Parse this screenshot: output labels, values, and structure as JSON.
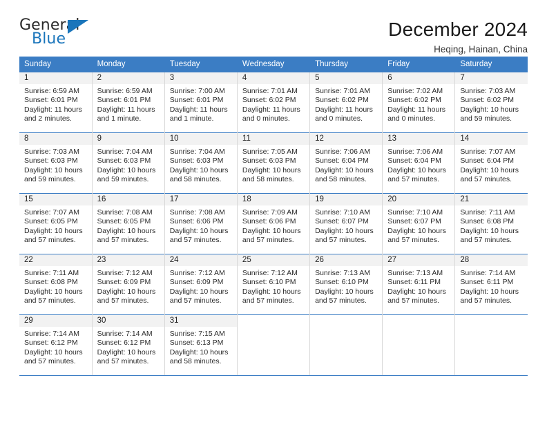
{
  "logo": {
    "word_one": "General",
    "word_two": "Blue",
    "flag_icon": "triangle-flag-icon"
  },
  "header": {
    "title": "December 2024",
    "location": "Heqing, Hainan, China"
  },
  "colors": {
    "header_blue": "#3b7dc4",
    "logo_blue": "#1a75bb",
    "daynum_band": "#f2f2f2",
    "cell_border": "#d8d8d8",
    "text": "#2b2b2b"
  },
  "weekday_headers": [
    "Sunday",
    "Monday",
    "Tuesday",
    "Wednesday",
    "Thursday",
    "Friday",
    "Saturday"
  ],
  "labels": {
    "sunrise_prefix": "Sunrise:",
    "sunset_prefix": "Sunset:",
    "daylight_prefix": "Daylight:"
  },
  "weeks": [
    [
      {
        "day": "1",
        "sunrise": "Sunrise: 6:59 AM",
        "sunset": "Sunset: 6:01 PM",
        "daylight_line1": "Daylight: 11 hours",
        "daylight_line2": "and 2 minutes."
      },
      {
        "day": "2",
        "sunrise": "Sunrise: 6:59 AM",
        "sunset": "Sunset: 6:01 PM",
        "daylight_line1": "Daylight: 11 hours",
        "daylight_line2": "and 1 minute."
      },
      {
        "day": "3",
        "sunrise": "Sunrise: 7:00 AM",
        "sunset": "Sunset: 6:01 PM",
        "daylight_line1": "Daylight: 11 hours",
        "daylight_line2": "and 1 minute."
      },
      {
        "day": "4",
        "sunrise": "Sunrise: 7:01 AM",
        "sunset": "Sunset: 6:02 PM",
        "daylight_line1": "Daylight: 11 hours",
        "daylight_line2": "and 0 minutes."
      },
      {
        "day": "5",
        "sunrise": "Sunrise: 7:01 AM",
        "sunset": "Sunset: 6:02 PM",
        "daylight_line1": "Daylight: 11 hours",
        "daylight_line2": "and 0 minutes."
      },
      {
        "day": "6",
        "sunrise": "Sunrise: 7:02 AM",
        "sunset": "Sunset: 6:02 PM",
        "daylight_line1": "Daylight: 11 hours",
        "daylight_line2": "and 0 minutes."
      },
      {
        "day": "7",
        "sunrise": "Sunrise: 7:03 AM",
        "sunset": "Sunset: 6:02 PM",
        "daylight_line1": "Daylight: 10 hours",
        "daylight_line2": "and 59 minutes."
      }
    ],
    [
      {
        "day": "8",
        "sunrise": "Sunrise: 7:03 AM",
        "sunset": "Sunset: 6:03 PM",
        "daylight_line1": "Daylight: 10 hours",
        "daylight_line2": "and 59 minutes."
      },
      {
        "day": "9",
        "sunrise": "Sunrise: 7:04 AM",
        "sunset": "Sunset: 6:03 PM",
        "daylight_line1": "Daylight: 10 hours",
        "daylight_line2": "and 59 minutes."
      },
      {
        "day": "10",
        "sunrise": "Sunrise: 7:04 AM",
        "sunset": "Sunset: 6:03 PM",
        "daylight_line1": "Daylight: 10 hours",
        "daylight_line2": "and 58 minutes."
      },
      {
        "day": "11",
        "sunrise": "Sunrise: 7:05 AM",
        "sunset": "Sunset: 6:03 PM",
        "daylight_line1": "Daylight: 10 hours",
        "daylight_line2": "and 58 minutes."
      },
      {
        "day": "12",
        "sunrise": "Sunrise: 7:06 AM",
        "sunset": "Sunset: 6:04 PM",
        "daylight_line1": "Daylight: 10 hours",
        "daylight_line2": "and 58 minutes."
      },
      {
        "day": "13",
        "sunrise": "Sunrise: 7:06 AM",
        "sunset": "Sunset: 6:04 PM",
        "daylight_line1": "Daylight: 10 hours",
        "daylight_line2": "and 57 minutes."
      },
      {
        "day": "14",
        "sunrise": "Sunrise: 7:07 AM",
        "sunset": "Sunset: 6:04 PM",
        "daylight_line1": "Daylight: 10 hours",
        "daylight_line2": "and 57 minutes."
      }
    ],
    [
      {
        "day": "15",
        "sunrise": "Sunrise: 7:07 AM",
        "sunset": "Sunset: 6:05 PM",
        "daylight_line1": "Daylight: 10 hours",
        "daylight_line2": "and 57 minutes."
      },
      {
        "day": "16",
        "sunrise": "Sunrise: 7:08 AM",
        "sunset": "Sunset: 6:05 PM",
        "daylight_line1": "Daylight: 10 hours",
        "daylight_line2": "and 57 minutes."
      },
      {
        "day": "17",
        "sunrise": "Sunrise: 7:08 AM",
        "sunset": "Sunset: 6:06 PM",
        "daylight_line1": "Daylight: 10 hours",
        "daylight_line2": "and 57 minutes."
      },
      {
        "day": "18",
        "sunrise": "Sunrise: 7:09 AM",
        "sunset": "Sunset: 6:06 PM",
        "daylight_line1": "Daylight: 10 hours",
        "daylight_line2": "and 57 minutes."
      },
      {
        "day": "19",
        "sunrise": "Sunrise: 7:10 AM",
        "sunset": "Sunset: 6:07 PM",
        "daylight_line1": "Daylight: 10 hours",
        "daylight_line2": "and 57 minutes."
      },
      {
        "day": "20",
        "sunrise": "Sunrise: 7:10 AM",
        "sunset": "Sunset: 6:07 PM",
        "daylight_line1": "Daylight: 10 hours",
        "daylight_line2": "and 57 minutes."
      },
      {
        "day": "21",
        "sunrise": "Sunrise: 7:11 AM",
        "sunset": "Sunset: 6:08 PM",
        "daylight_line1": "Daylight: 10 hours",
        "daylight_line2": "and 57 minutes."
      }
    ],
    [
      {
        "day": "22",
        "sunrise": "Sunrise: 7:11 AM",
        "sunset": "Sunset: 6:08 PM",
        "daylight_line1": "Daylight: 10 hours",
        "daylight_line2": "and 57 minutes."
      },
      {
        "day": "23",
        "sunrise": "Sunrise: 7:12 AM",
        "sunset": "Sunset: 6:09 PM",
        "daylight_line1": "Daylight: 10 hours",
        "daylight_line2": "and 57 minutes."
      },
      {
        "day": "24",
        "sunrise": "Sunrise: 7:12 AM",
        "sunset": "Sunset: 6:09 PM",
        "daylight_line1": "Daylight: 10 hours",
        "daylight_line2": "and 57 minutes."
      },
      {
        "day": "25",
        "sunrise": "Sunrise: 7:12 AM",
        "sunset": "Sunset: 6:10 PM",
        "daylight_line1": "Daylight: 10 hours",
        "daylight_line2": "and 57 minutes."
      },
      {
        "day": "26",
        "sunrise": "Sunrise: 7:13 AM",
        "sunset": "Sunset: 6:10 PM",
        "daylight_line1": "Daylight: 10 hours",
        "daylight_line2": "and 57 minutes."
      },
      {
        "day": "27",
        "sunrise": "Sunrise: 7:13 AM",
        "sunset": "Sunset: 6:11 PM",
        "daylight_line1": "Daylight: 10 hours",
        "daylight_line2": "and 57 minutes."
      },
      {
        "day": "28",
        "sunrise": "Sunrise: 7:14 AM",
        "sunset": "Sunset: 6:11 PM",
        "daylight_line1": "Daylight: 10 hours",
        "daylight_line2": "and 57 minutes."
      }
    ],
    [
      {
        "day": "29",
        "sunrise": "Sunrise: 7:14 AM",
        "sunset": "Sunset: 6:12 PM",
        "daylight_line1": "Daylight: 10 hours",
        "daylight_line2": "and 57 minutes."
      },
      {
        "day": "30",
        "sunrise": "Sunrise: 7:14 AM",
        "sunset": "Sunset: 6:12 PM",
        "daylight_line1": "Daylight: 10 hours",
        "daylight_line2": "and 57 minutes."
      },
      {
        "day": "31",
        "sunrise": "Sunrise: 7:15 AM",
        "sunset": "Sunset: 6:13 PM",
        "daylight_line1": "Daylight: 10 hours",
        "daylight_line2": "and 58 minutes."
      },
      {
        "day": "",
        "sunrise": "",
        "sunset": "",
        "daylight_line1": "",
        "daylight_line2": ""
      },
      {
        "day": "",
        "sunrise": "",
        "sunset": "",
        "daylight_line1": "",
        "daylight_line2": ""
      },
      {
        "day": "",
        "sunrise": "",
        "sunset": "",
        "daylight_line1": "",
        "daylight_line2": ""
      },
      {
        "day": "",
        "sunrise": "",
        "sunset": "",
        "daylight_line1": "",
        "daylight_line2": ""
      }
    ]
  ]
}
